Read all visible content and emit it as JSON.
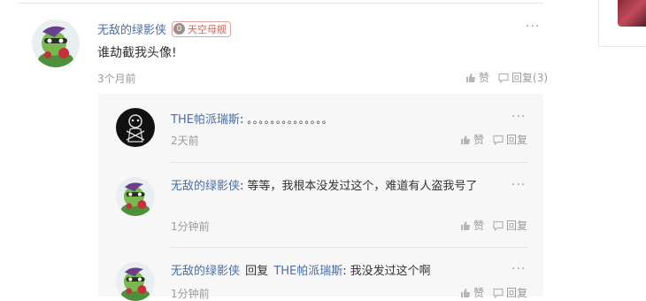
{
  "comment": {
    "author": "无敌的绿影侠",
    "badge_level": "0",
    "badge_label": "天空母舰",
    "text": "谁劫截我头像!",
    "time": "3个月前",
    "like_label": "赞",
    "reply_label": "回复(3)",
    "more": "···"
  },
  "replies": [
    {
      "author": "THE帕派瑞斯",
      "colon": ":",
      "text": "。。。。。。。。。。。。。。",
      "time": "2天前",
      "like_label": "赞",
      "reply_label": "回复",
      "more": "···"
    },
    {
      "author": "无敌的绿影侠",
      "colon": ":",
      "text": "等等，我根本没发过这个，难道有人盗我号了",
      "time": "1分钟前",
      "like_label": "赞",
      "reply_label": "回复",
      "more": "···"
    },
    {
      "author": "无敌的绿影侠",
      "reply_word": "回复",
      "reply_to": "THE帕派瑞斯",
      "colon": ":",
      "text": "我没发过这个啊",
      "time": "1分钟前",
      "like_label": "赞",
      "reply_label": "回复",
      "more": "···"
    }
  ]
}
